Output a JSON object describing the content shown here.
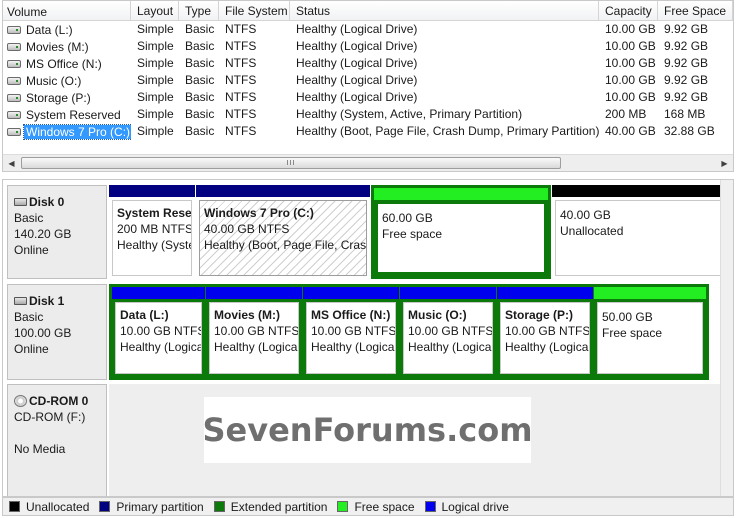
{
  "volume_list": {
    "columns": [
      "Volume",
      "Layout",
      "Type",
      "File System",
      "Status",
      "Capacity",
      "Free Space"
    ],
    "rows": [
      {
        "volume": "Data (L:)",
        "layout": "Simple",
        "type": "Basic",
        "fs": "NTFS",
        "status": "Healthy (Logical Drive)",
        "capacity": "10.00 GB",
        "free": "9.92 GB"
      },
      {
        "volume": "Movies (M:)",
        "layout": "Simple",
        "type": "Basic",
        "fs": "NTFS",
        "status": "Healthy (Logical Drive)",
        "capacity": "10.00 GB",
        "free": "9.92 GB"
      },
      {
        "volume": "MS Office (N:)",
        "layout": "Simple",
        "type": "Basic",
        "fs": "NTFS",
        "status": "Healthy (Logical Drive)",
        "capacity": "10.00 GB",
        "free": "9.92 GB"
      },
      {
        "volume": "Music (O:)",
        "layout": "Simple",
        "type": "Basic",
        "fs": "NTFS",
        "status": "Healthy (Logical Drive)",
        "capacity": "10.00 GB",
        "free": "9.92 GB"
      },
      {
        "volume": "Storage (P:)",
        "layout": "Simple",
        "type": "Basic",
        "fs": "NTFS",
        "status": "Healthy (Logical Drive)",
        "capacity": "10.00 GB",
        "free": "9.92 GB"
      },
      {
        "volume": "System Reserved",
        "layout": "Simple",
        "type": "Basic",
        "fs": "NTFS",
        "status": "Healthy (System, Active, Primary Partition)",
        "capacity": "200 MB",
        "free": "168 MB"
      },
      {
        "volume": "Windows 7 Pro (C:)",
        "layout": "Simple",
        "type": "Basic",
        "fs": "NTFS",
        "status": "Healthy (Boot, Page File, Crash Dump, Primary Partition)",
        "capacity": "40.00 GB",
        "free": "32.88 GB",
        "selected": true
      }
    ],
    "scroll_grip": "III"
  },
  "disks": [
    {
      "name": "Disk 0",
      "type": "Basic",
      "size": "140.20 GB",
      "status": "Online",
      "partitions": [
        {
          "name": "System Rese",
          "size": "200 MB NTFS",
          "status": "Healthy (Syste",
          "bar_color": "#000080"
        },
        {
          "name": "Windows 7 Pro  (C:)",
          "size": "40.00 GB NTFS",
          "status": "Healthy (Boot, Page File, Crash",
          "bar_color": "#000080"
        },
        {
          "name": "",
          "size": "60.00 GB",
          "status": "Free space",
          "bar_color": "#22ee22"
        },
        {
          "name": "",
          "size": "40.00 GB",
          "status": "Unallocated",
          "bar_color": "#000000"
        }
      ]
    },
    {
      "name": "Disk 1",
      "type": "Basic",
      "size": "100.00 GB",
      "status": "Online",
      "partitions": [
        {
          "name": "Data  (L:)",
          "size": "10.00 GB NTFS",
          "status": "Healthy (Logica",
          "bar_color": "#0000ee"
        },
        {
          "name": "Movies  (M:)",
          "size": "10.00 GB NTFS",
          "status": "Healthy (Logica",
          "bar_color": "#0000ee"
        },
        {
          "name": "MS Office  (N:)",
          "size": "10.00 GB NTFS",
          "status": "Healthy (Logica",
          "bar_color": "#0000ee"
        },
        {
          "name": "Music  (O:)",
          "size": "10.00 GB NTFS",
          "status": "Healthy (Logica",
          "bar_color": "#0000ee"
        },
        {
          "name": "Storage  (P:)",
          "size": "10.00 GB NTFS",
          "status": "Healthy (Logica",
          "bar_color": "#0000ee"
        },
        {
          "name": "",
          "size": "50.00 GB",
          "status": "Free space",
          "bar_color": "#22ee22"
        }
      ]
    }
  ],
  "cdrom": {
    "name": "CD-ROM 0",
    "drive": "CD-ROM (F:)",
    "media": "No Media"
  },
  "watermark": "SevenForums.com",
  "legend": [
    {
      "label": "Unallocated",
      "color": "#000000"
    },
    {
      "label": "Primary partition",
      "color": "#000080"
    },
    {
      "label": "Extended partition",
      "color": "#0b7a0b"
    },
    {
      "label": "Free space",
      "color": "#22ee22"
    },
    {
      "label": "Logical drive",
      "color": "#0000ee"
    }
  ],
  "colors": {
    "selection": "#3399ff",
    "extended_border": "#0b7a0b"
  }
}
